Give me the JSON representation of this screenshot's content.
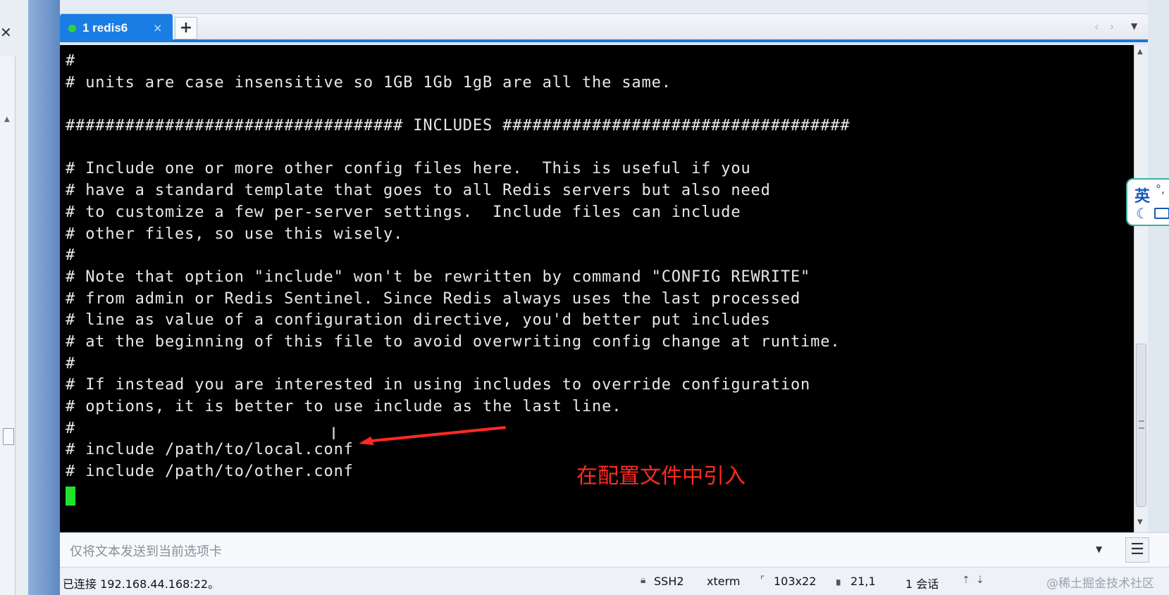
{
  "tab": {
    "label": "1 redis6",
    "close": "×",
    "add": "+"
  },
  "terminal": {
    "lines": [
      "#",
      "# units are case insensitive so 1GB 1Gb 1gB are all the same.",
      "",
      "################################## INCLUDES ###################################",
      "",
      "# Include one or more other config files here.  This is useful if you",
      "# have a standard template that goes to all Redis servers but also need",
      "# to customize a few per-server settings.  Include files can include",
      "# other files, so use this wisely.",
      "#",
      "# Note that option \"include\" won't be rewritten by command \"CONFIG REWRITE\"",
      "# from admin or Redis Sentinel. Since Redis always uses the last processed",
      "# line as value of a configuration directive, you'd better put includes",
      "# at the beginning of this file to avoid overwriting config change at runtime.",
      "#",
      "# If instead you are interested in using includes to override configuration",
      "# options, it is better to use include as the last line.",
      "#",
      "# include /path/to/local.conf",
      "# include /path/to/other.conf"
    ]
  },
  "annotation": {
    "text": "在配置文件中引入",
    "color": "#ff2a22"
  },
  "ime": {
    "label": "英",
    "dots": "°,"
  },
  "send_bar": {
    "placeholder": "仅将文本发送到当前选项卡"
  },
  "status": {
    "connection": "已连接 192.168.44.168:22。",
    "protocol": "SSH2",
    "terminal_type": "xterm",
    "size": "103x22",
    "position": "21,1",
    "sessions": "1 会话",
    "watermark": "@稀土掘金技术社区"
  },
  "colors": {
    "accent": "#1a7de4",
    "terminal_bg": "#000000",
    "terminal_fg": "#e8e8e8",
    "cursor": "#1fe32f"
  }
}
